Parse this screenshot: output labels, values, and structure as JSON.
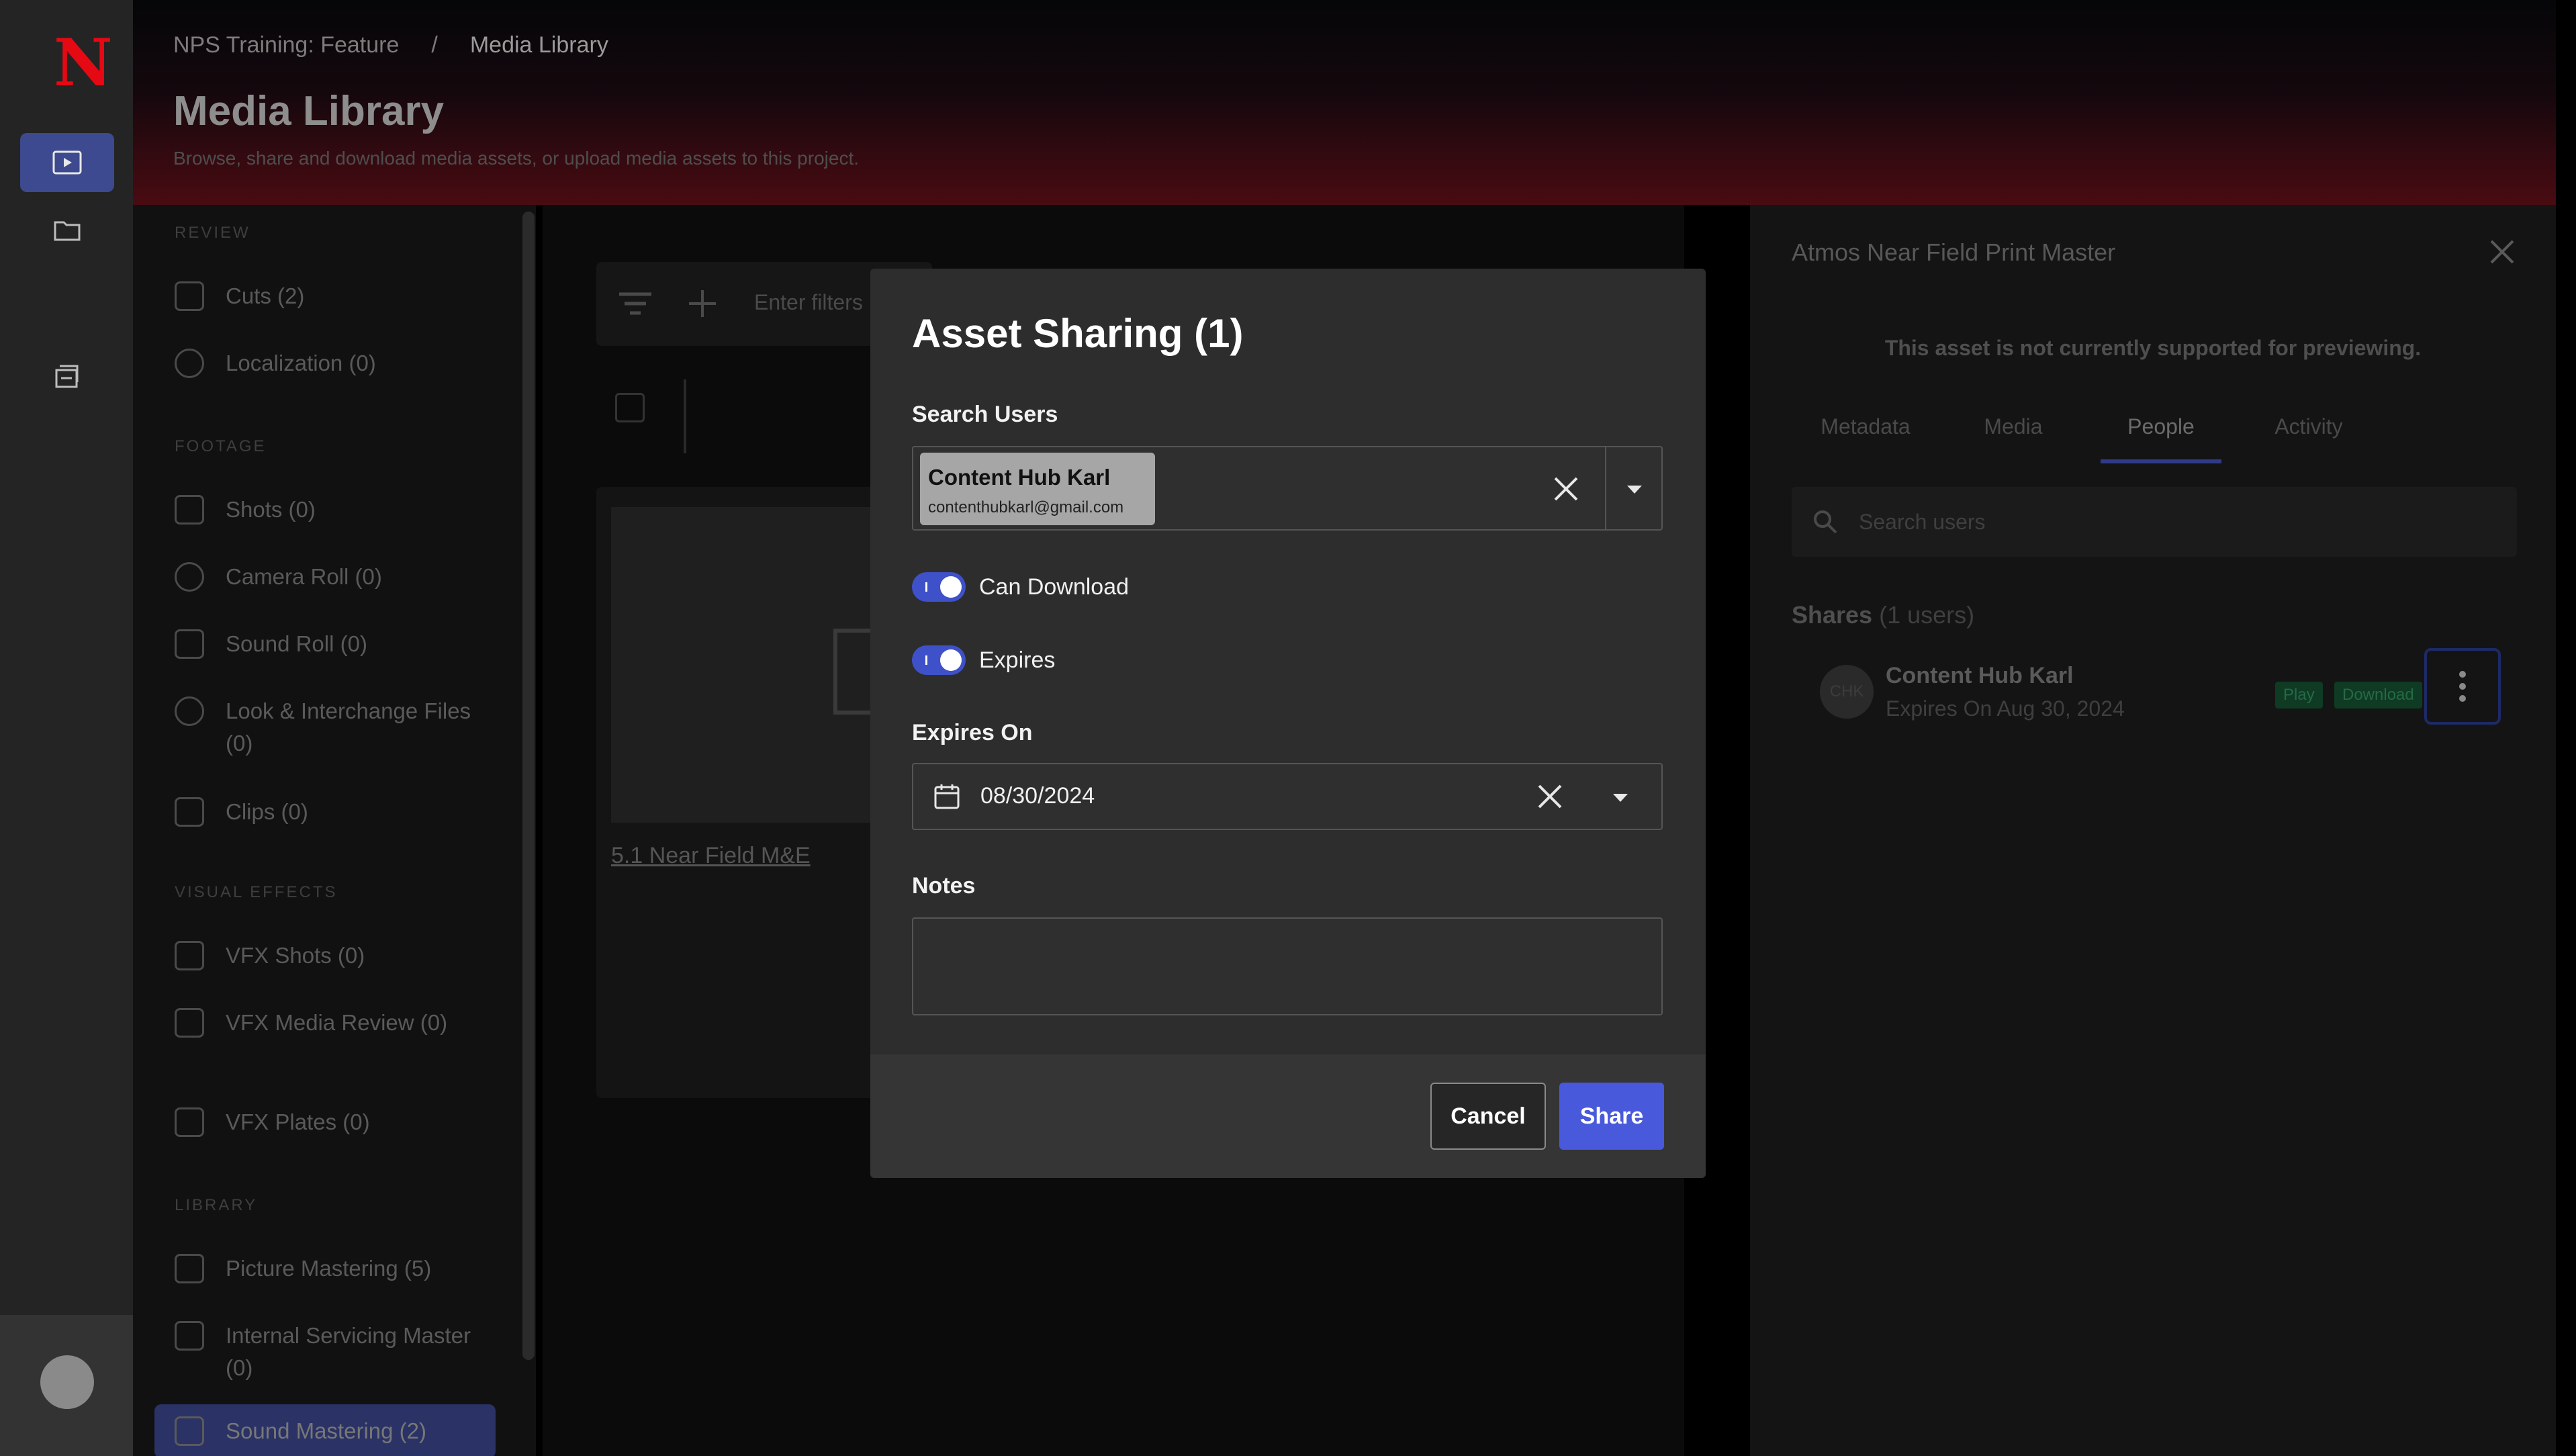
{
  "rail": {
    "logo": "N",
    "items": [
      {
        "name": "media-library",
        "active": true
      },
      {
        "name": "folders",
        "active": false
      },
      {
        "name": "deliveries",
        "active": false
      }
    ]
  },
  "header": {
    "breadcrumb": [
      "NPS Training: Feature",
      "/",
      "Media Library"
    ],
    "title": "Media Library",
    "subtitle": "Browse, share and download media assets, or upload media assets to this project."
  },
  "sidebar": {
    "sections": [
      {
        "label": "Review",
        "items": [
          "Cuts (2)",
          "Localization (0)"
        ]
      },
      {
        "label": "Footage",
        "items": [
          "Shots (0)",
          "Camera Roll (0)",
          "Sound Roll (0)",
          "Look & Interchange Files (0)",
          "Clips (0)"
        ]
      },
      {
        "label": "Visual Effects",
        "items": [
          "VFX Shots (0)",
          "VFX Media Review (0)",
          "VFX Plates (0)"
        ]
      },
      {
        "label": "Library",
        "items": [
          "Picture Mastering (5)",
          "Internal Servicing Master (0)",
          "Sound Mastering (2)"
        ]
      }
    ]
  },
  "main": {
    "filter_placeholder": "Enter filters",
    "card_title": "5.1 Near Field M&E"
  },
  "right_panel": {
    "title": "Atmos Near Field Print Master",
    "preview_note": "This asset is not currently supported for previewing.",
    "tabs": [
      "Metadata",
      "Media",
      "People",
      "Activity"
    ],
    "active_tab": "People",
    "search_placeholder": "Search users",
    "shares_label": "Shares",
    "shares_count": "(1 users)",
    "user": {
      "initials": "CHK",
      "name": "Content Hub Karl",
      "expires": "Expires On Aug 30, 2024",
      "badges": [
        "Play",
        "Download"
      ]
    }
  },
  "modal": {
    "title": "Asset Sharing (1)",
    "search_label": "Search Users",
    "selected_user": {
      "name": "Content Hub Karl",
      "email": "contenthubkarl@gmail.com"
    },
    "can_download_label": "Can Download",
    "can_download": true,
    "expires_label": "Expires",
    "expires": true,
    "expires_on_label": "Expires On",
    "expires_on_value": "08/30/2024",
    "notes_label": "Notes",
    "notes_value": "",
    "cancel_label": "Cancel",
    "share_label": "Share"
  },
  "colors": {
    "accent": "#4959db",
    "toggle_on": "#3f51c8",
    "brand_red": "#e50914"
  }
}
